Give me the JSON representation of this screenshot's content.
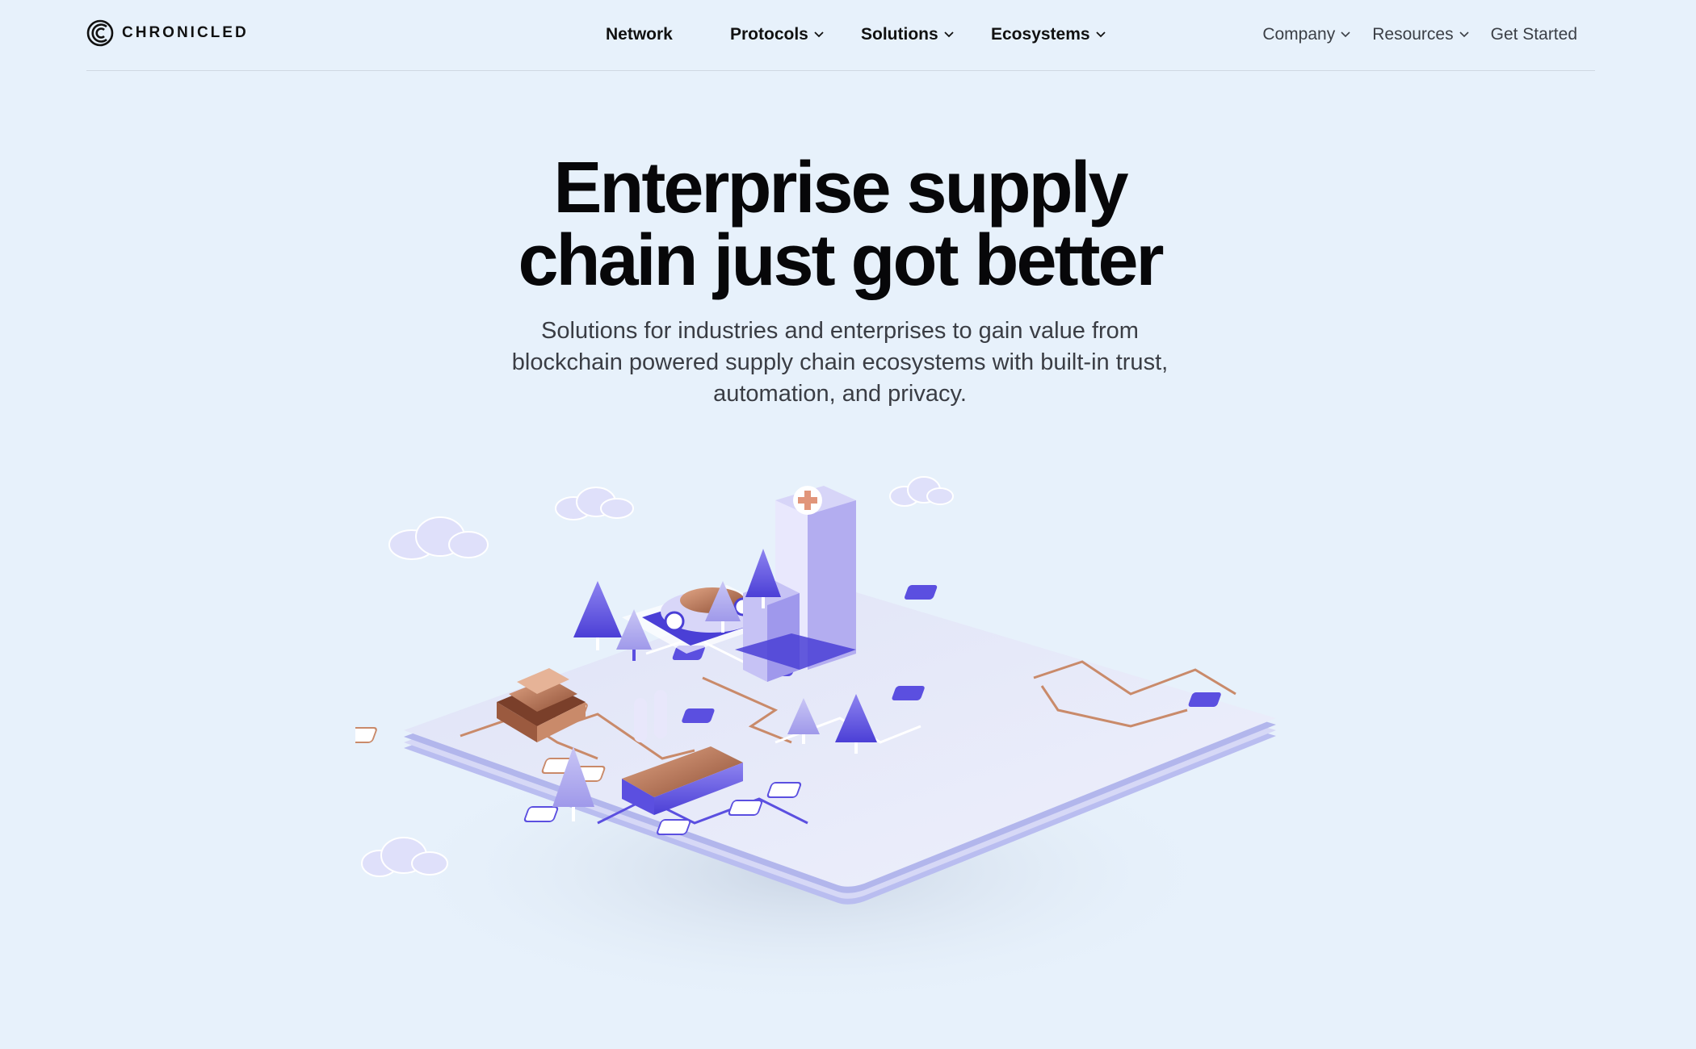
{
  "brand": {
    "name": "CHRONICLED"
  },
  "nav": {
    "main": [
      {
        "label": "Network",
        "has_dropdown": false
      },
      {
        "label": "Protocols",
        "has_dropdown": true
      },
      {
        "label": "Solutions",
        "has_dropdown": true
      },
      {
        "label": "Ecosystems",
        "has_dropdown": true
      }
    ],
    "secondary": [
      {
        "label": "Company",
        "has_dropdown": true
      },
      {
        "label": "Resources",
        "has_dropdown": true
      },
      {
        "label": "Get Started",
        "has_dropdown": false
      }
    ]
  },
  "hero": {
    "title_line1": "Enterprise supply",
    "title_line2": "chain just got better",
    "subtitle": "Solutions for industries and enterprises to gain value from blockchain powered supply chain ecosystems with built-in trust, automation, and privacy."
  },
  "colors": {
    "background": "#e7f1fb",
    "accent_purple": "#5b4fe0",
    "copper": "#c98a6a",
    "text": "#0b0b0f"
  },
  "icons": {
    "logo": "chronicled-logo-icon",
    "dropdown": "chevron-down-icon"
  }
}
